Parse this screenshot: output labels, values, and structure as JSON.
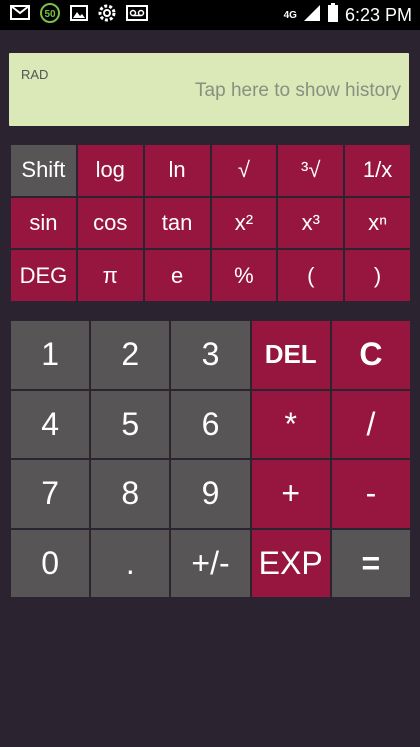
{
  "status_bar": {
    "time": "6:23 PM",
    "badge": "50",
    "network": "4G",
    "icons": [
      "mail-icon",
      "badge-50-icon",
      "image-icon",
      "settings-icon",
      "voicemail-icon",
      "signal-icon",
      "battery-icon"
    ]
  },
  "display": {
    "mode": "RAD",
    "history_hint": "Tap here to show history"
  },
  "scientific": {
    "rows": [
      [
        "Shift",
        "log",
        "ln",
        "√",
        "³√",
        "1/x"
      ],
      [
        "sin",
        "cos",
        "tan",
        "x²",
        "x³",
        "xⁿ"
      ],
      [
        "DEG",
        "π",
        "e",
        "%",
        "(",
        ")"
      ]
    ]
  },
  "keypad": {
    "rows": [
      [
        "1",
        "2",
        "3",
        "DEL",
        "C"
      ],
      [
        "4",
        "5",
        "6",
        "*",
        "/"
      ],
      [
        "7",
        "8",
        "9",
        "+",
        "-"
      ],
      [
        "0",
        ".",
        "+/-",
        "EXP",
        "="
      ]
    ]
  },
  "colors": {
    "background": "#2b2430",
    "accent": "#961640",
    "key_gray": "#575555",
    "display_bg": "#dbe8b8"
  }
}
